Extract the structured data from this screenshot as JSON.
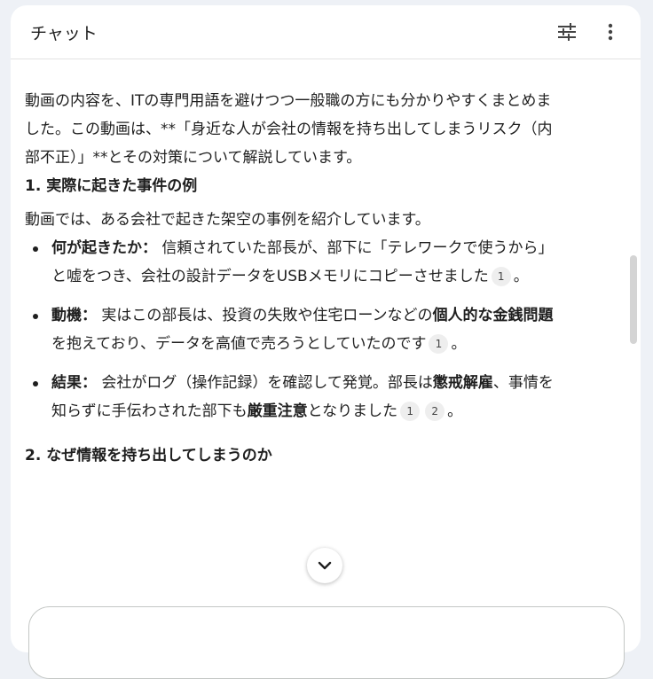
{
  "header": {
    "title": "チャット",
    "icons": [
      "tune-icon",
      "more-vert-icon"
    ]
  },
  "intro": "動画の内容を、ITの専門用語を避けつつ一般職の方にも分かりやすくまとめました。この動画は、**「身近な人が会社の情報を持ち出してしまうリスク（内部不正）」**とその対策について解説しています。",
  "section1": {
    "heading": "1. 実際に起きた事件の例",
    "lead": "動画では、ある会社で起きた架空の事例を紹介しています。",
    "items": [
      {
        "label": "何が起きたか：",
        "text": "信頼されていた部長が、部下に「テレワークで使うから」と嘘をつき、会社の設計データをUSBメモリにコピーさせました",
        "cite1": "1",
        "end": "。"
      },
      {
        "label": "動機：",
        "text_a": "実はこの部長は、投資の失敗や住宅ローンなどの",
        "bold": "個人的な金銭問題",
        "text_b": "を抱えており、データを高値で売ろうとしていたのです",
        "cite1": "1",
        "end": "。"
      },
      {
        "label": "結果：",
        "text_a": "会社がログ（操作記録）を確認して発覚。部長は",
        "bold1": "懲戒解雇",
        "text_b": "、事情を知らずに手伝わされた部下も",
        "bold2": "厳重注意",
        "text_c": "となりました",
        "cite1": "1",
        "cite2": "2",
        "end": "。"
      }
    ]
  },
  "section2": {
    "heading": "2. なぜ情報を持ち出してしまうのか"
  }
}
